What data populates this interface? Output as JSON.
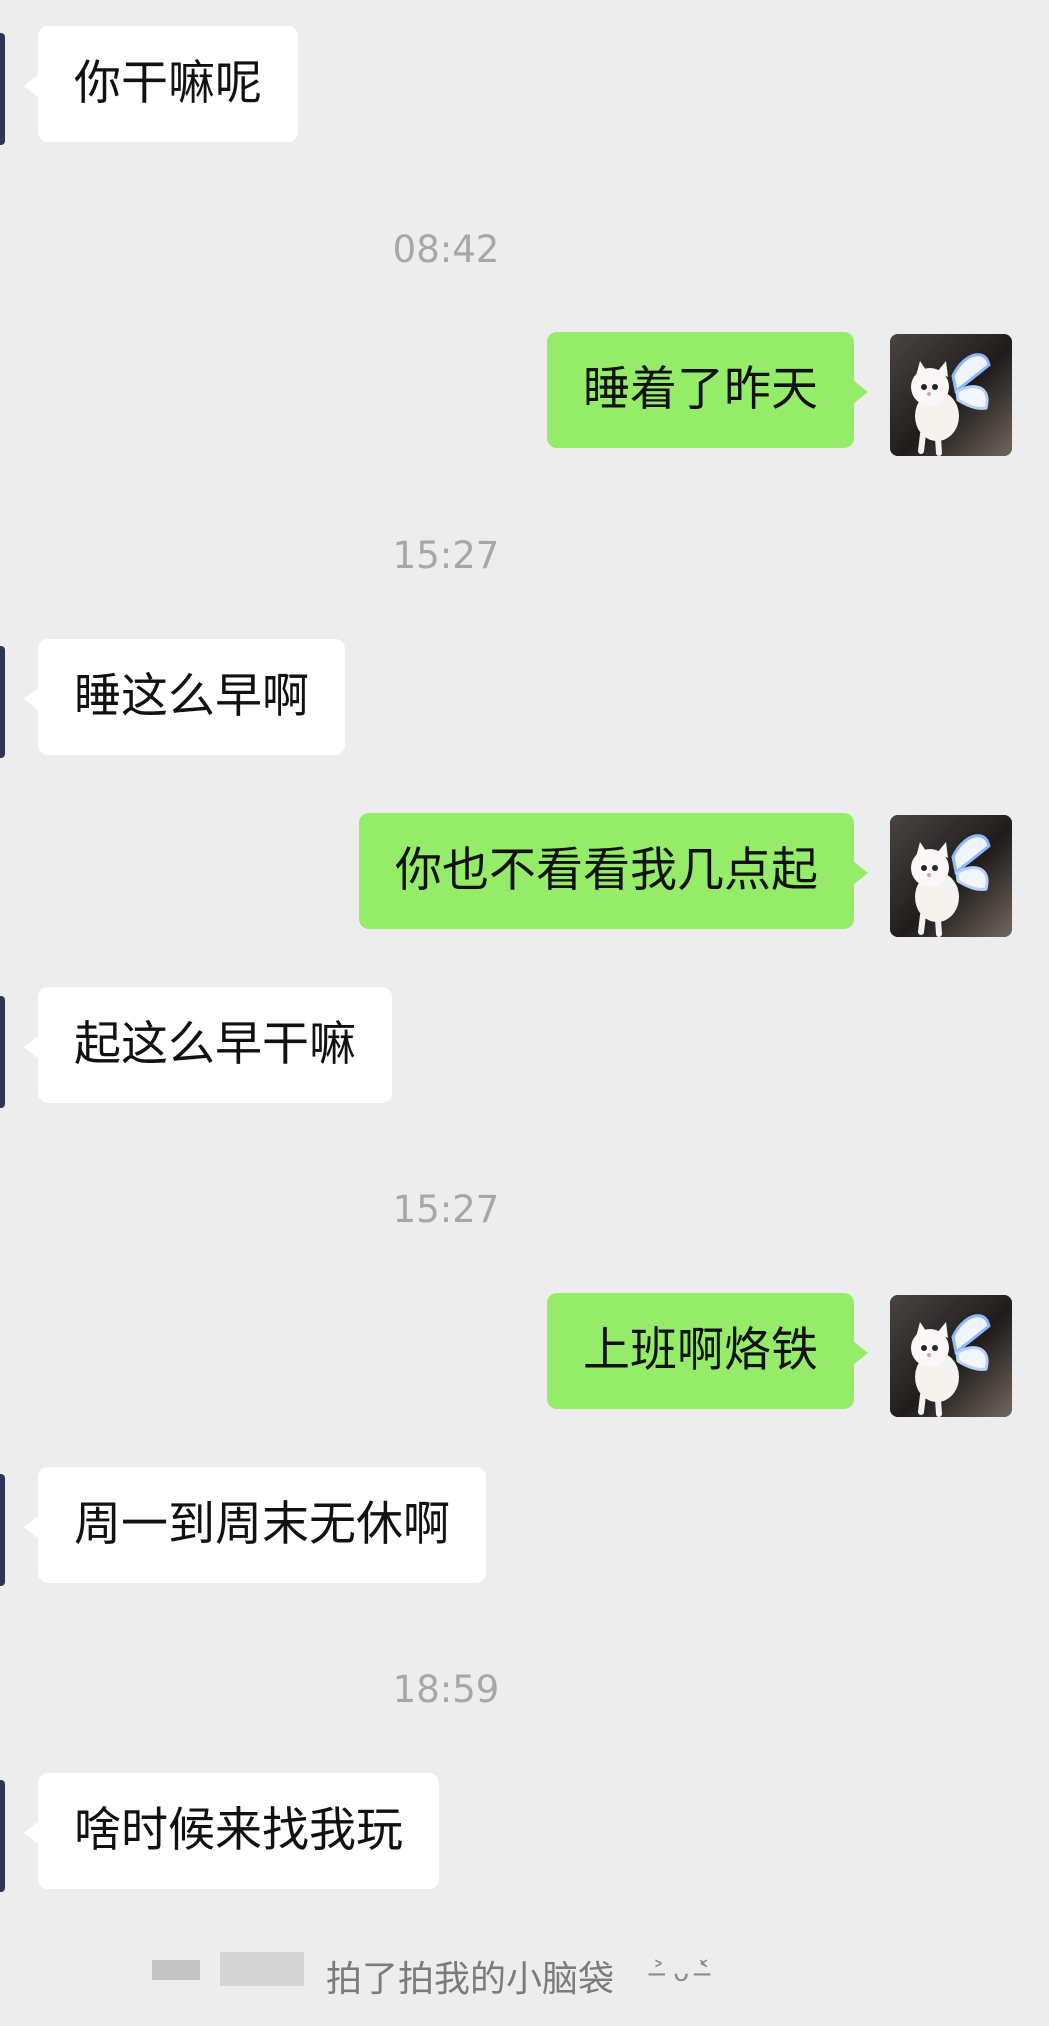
{
  "chat": {
    "messages": [
      {
        "kind": "incoming",
        "text": "你干嘛呢"
      },
      {
        "kind": "time",
        "text": "08:42"
      },
      {
        "kind": "outgoing",
        "text": "睡着了昨天",
        "avatar": "white-kitten-with-wings-avatar"
      },
      {
        "kind": "time",
        "text": "15:27"
      },
      {
        "kind": "incoming",
        "text": "睡这么早啊"
      },
      {
        "kind": "outgoing",
        "text": "你也不看看我几点起",
        "avatar": "white-kitten-with-wings-avatar"
      },
      {
        "kind": "incoming",
        "text": "起这么早干嘛"
      },
      {
        "kind": "time",
        "text": "15:27"
      },
      {
        "kind": "outgoing",
        "text": "上班啊烙铁",
        "avatar": "white-kitten-with-wings-avatar"
      },
      {
        "kind": "incoming",
        "text": "周一到周末无休啊"
      },
      {
        "kind": "time",
        "text": "18:59"
      },
      {
        "kind": "incoming",
        "text": "啥时候来找我玩"
      }
    ],
    "pat_notice": {
      "text": "拍了拍我的小脑袋",
      "suffix": "˃̶ ᴗ ˂̶̀"
    }
  },
  "colors": {
    "background": "#ededed",
    "incoming_bubble": "#ffffff",
    "outgoing_bubble": "#95ec69",
    "timestamp": "#a7a7a7"
  }
}
